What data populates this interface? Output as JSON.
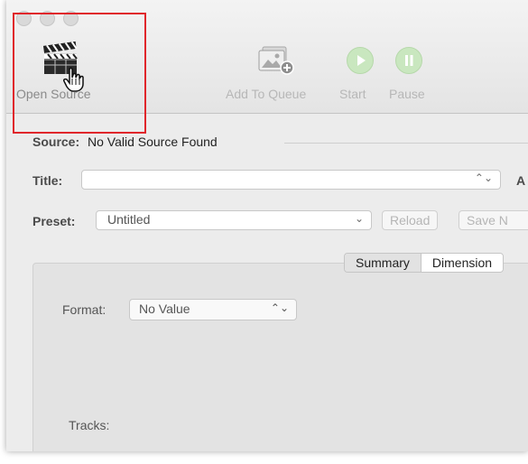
{
  "toolbar": {
    "open_source_label": "Open Source",
    "add_to_queue_label": "Add To Queue",
    "start_label": "Start",
    "pause_label": "Pause"
  },
  "source": {
    "label": "Source:",
    "value": "No Valid Source Found"
  },
  "title_row": {
    "label": "Title:",
    "value": "",
    "trailing_label": "A"
  },
  "preset_row": {
    "label": "Preset:",
    "value": "Untitled",
    "reload_label": "Reload",
    "save_label": "Save N"
  },
  "tabs": [
    {
      "label": "Summary",
      "selected": true
    },
    {
      "label": "Dimension",
      "selected": false
    }
  ],
  "summary": {
    "format_label": "Format:",
    "format_value": "No Value",
    "tracks_label": "Tracks:"
  },
  "colors": {
    "highlight": "#e0262b",
    "start_pause_green": "#c9e7bf"
  },
  "icons": [
    "close-icon",
    "minimize-icon",
    "zoom-icon",
    "clapperboard-icon",
    "pointer-hand-icon",
    "add-to-queue-icon",
    "play-icon",
    "pause-icon",
    "chevron-updown-icon",
    "chevron-down-icon"
  ]
}
